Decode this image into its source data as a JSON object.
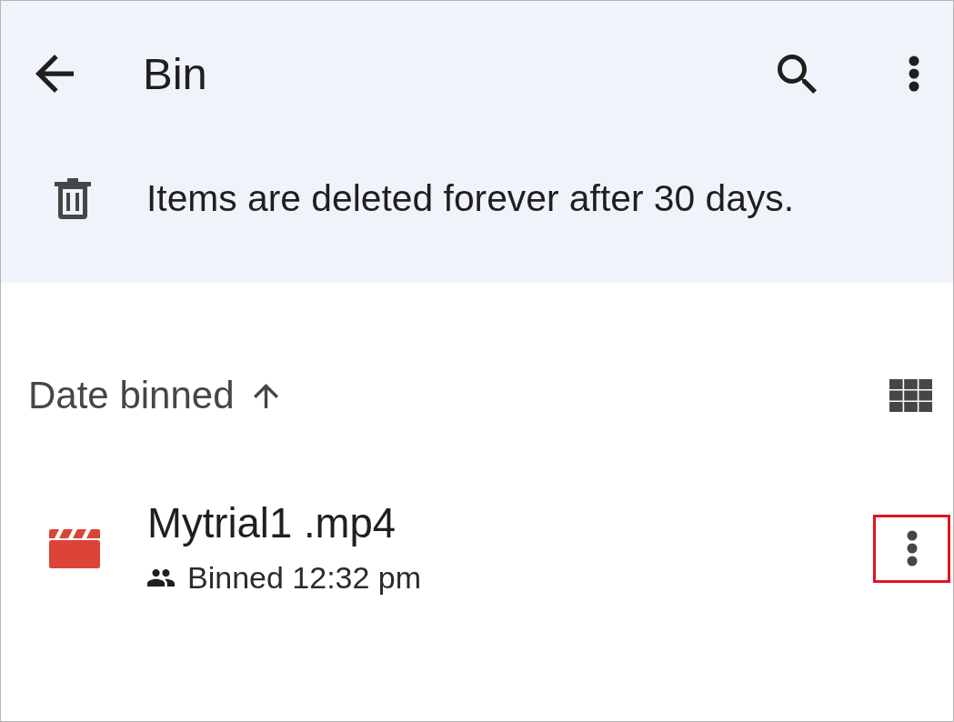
{
  "app_bar": {
    "title": "Bin"
  },
  "notice": {
    "text": "Items are deleted forever after 30 days."
  },
  "sort": {
    "label": "Date binned",
    "ascending": true
  },
  "files": [
    {
      "kind": "video",
      "name": "Mytrial1 .mp4",
      "shared": true,
      "detail": "Binned 12:32 pm",
      "menu_highlighted": true
    }
  ]
}
